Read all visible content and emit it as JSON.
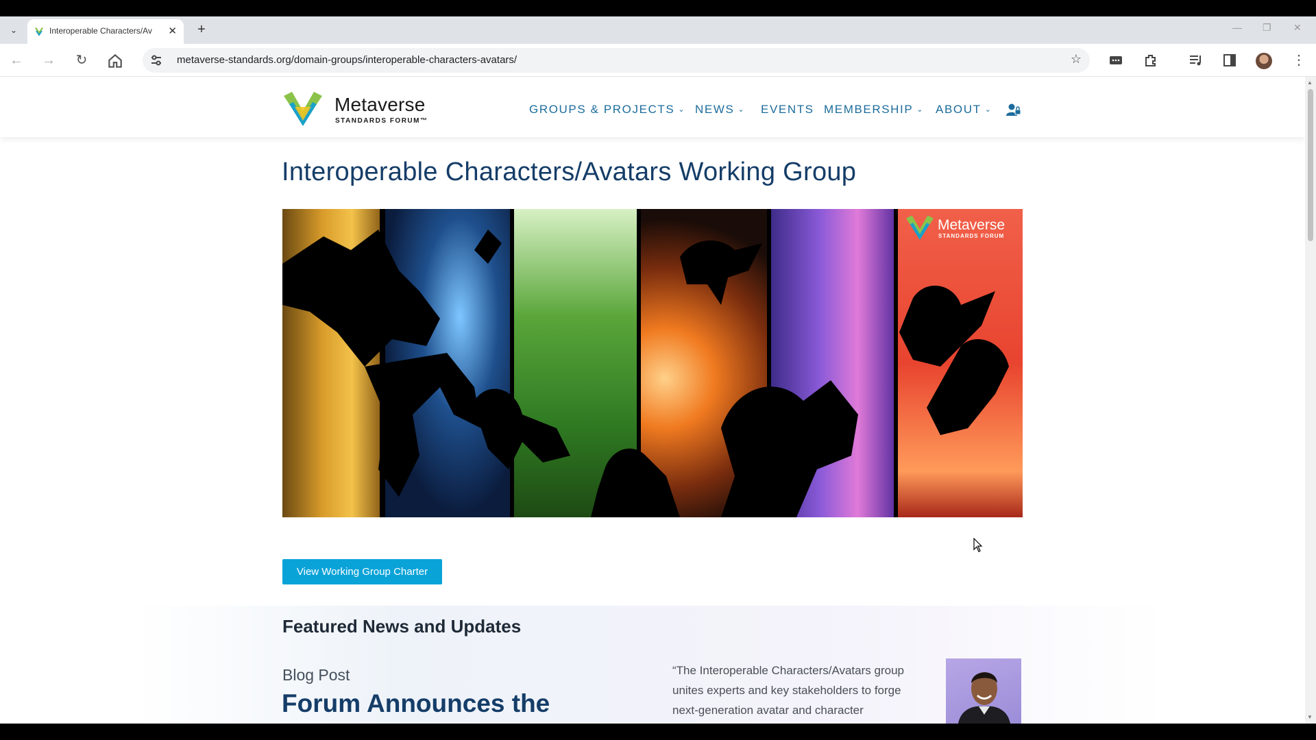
{
  "browser": {
    "tab_title": "Interoperable Characters/Av",
    "url": "metaverse-standards.org/domain-groups/interoperable-characters-avatars/"
  },
  "site": {
    "logo_word": "Metaverse",
    "logo_sub": "STANDARDS FORUM™",
    "nav": [
      {
        "label": "GROUPS & PROJECTS"
      },
      {
        "label": "NEWS"
      },
      {
        "label": "EVENTS"
      },
      {
        "label": "MEMBERSHIP"
      },
      {
        "label": "ABOUT"
      }
    ]
  },
  "main": {
    "title": "Interoperable Characters/Avatars Working Group",
    "hero_logo_word": "Metaverse",
    "hero_logo_sub": "STANDARDS FORUM",
    "charter_button": "View Working Group Charter",
    "featured_title": "Featured News and Updates",
    "post_type": "Blog Post",
    "post_headline": "Forum Announces the",
    "quote_lines": [
      "“The Interoperable Characters/Avatars group",
      "unites experts and key stakeholders to forge",
      "next-generation avatar and character"
    ]
  },
  "colors": {
    "accent": "#0aa3d8",
    "nav_blue": "#1c6c9c",
    "title_navy": "#153d68"
  }
}
